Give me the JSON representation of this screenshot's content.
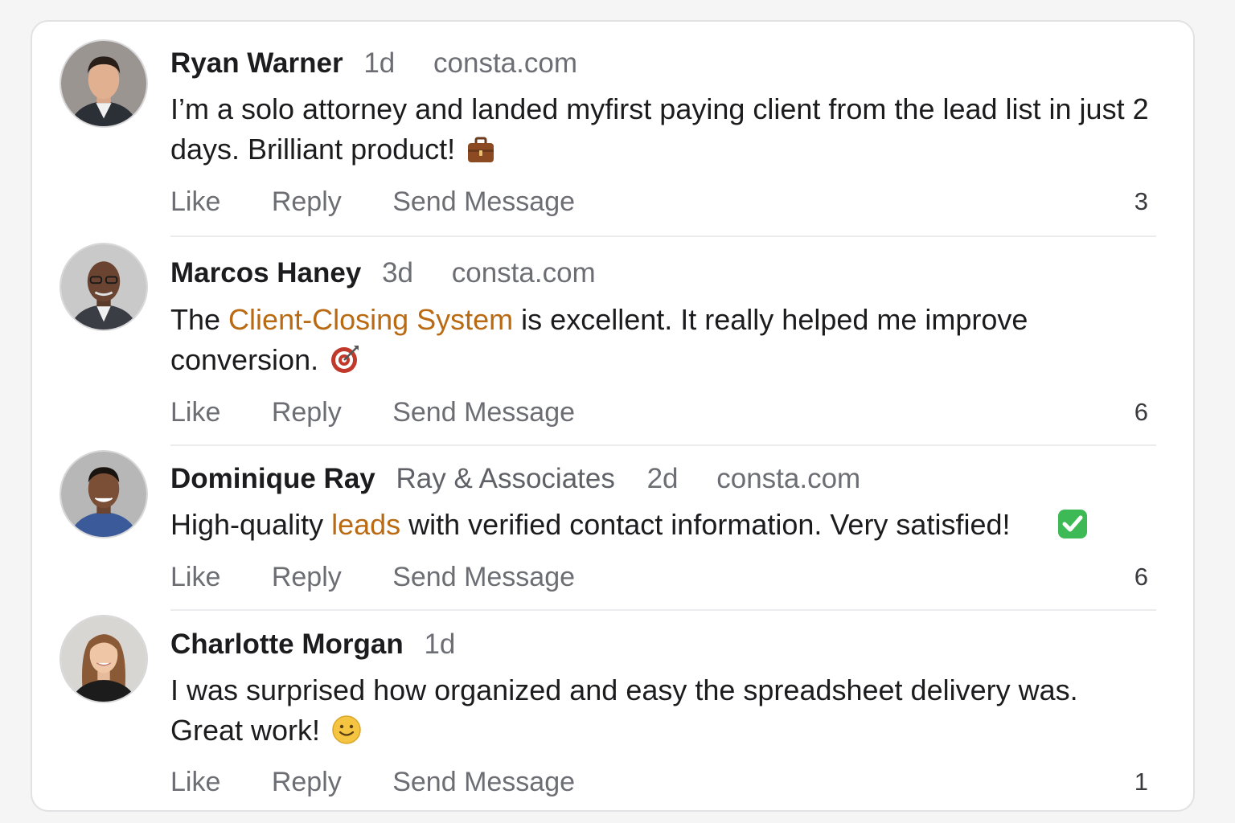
{
  "comments": [
    {
      "author": "Ryan Warner",
      "organization": "",
      "time": "1d",
      "domain": "consta.com",
      "text_before": "I’m a solo attorney and landed myfirst paying client from the lead list in just 2 days. Brilliant product!",
      "highlight": "",
      "text_after": "",
      "emoji": "briefcase-icon",
      "like_label": "Like",
      "reply_label": "Reply",
      "send_label": "Send Message",
      "count": "3"
    },
    {
      "author": "Marcos Haney",
      "organization": "",
      "time": "3d",
      "domain": "consta.com",
      "text_before": "The ",
      "highlight": "Client-Closing System",
      "text_after": " is excellent. It really helped me improve conversion.",
      "emoji": "target-icon",
      "like_label": "Like",
      "reply_label": "Reply",
      "send_label": "Send Message",
      "count": "6"
    },
    {
      "author": "Dominique Ray",
      "organization": "Ray & Associates",
      "time": "2d",
      "domain": "consta.com",
      "text_before": "High-quality ",
      "highlight": "leads",
      "text_after": " with verified contact information. Very satisfied!",
      "emoji": "check-mark-icon",
      "like_label": "Like",
      "reply_label": "Reply",
      "send_label": "Send Message",
      "count": "6"
    },
    {
      "author": "Charlotte Morgan",
      "organization": "",
      "time": "1d",
      "domain": "",
      "text_before": "I was surprised how organized and easy the spreadsheet delivery was. Great work!",
      "highlight": "",
      "text_after": "",
      "emoji": "smiley-icon",
      "like_label": "Like",
      "reply_label": "Reply",
      "send_label": "Send Message",
      "count": "1"
    }
  ],
  "colors": {
    "highlight": "#b96a12",
    "muted_text": "#6c6e74",
    "primary_text": "#1c1c1e"
  }
}
